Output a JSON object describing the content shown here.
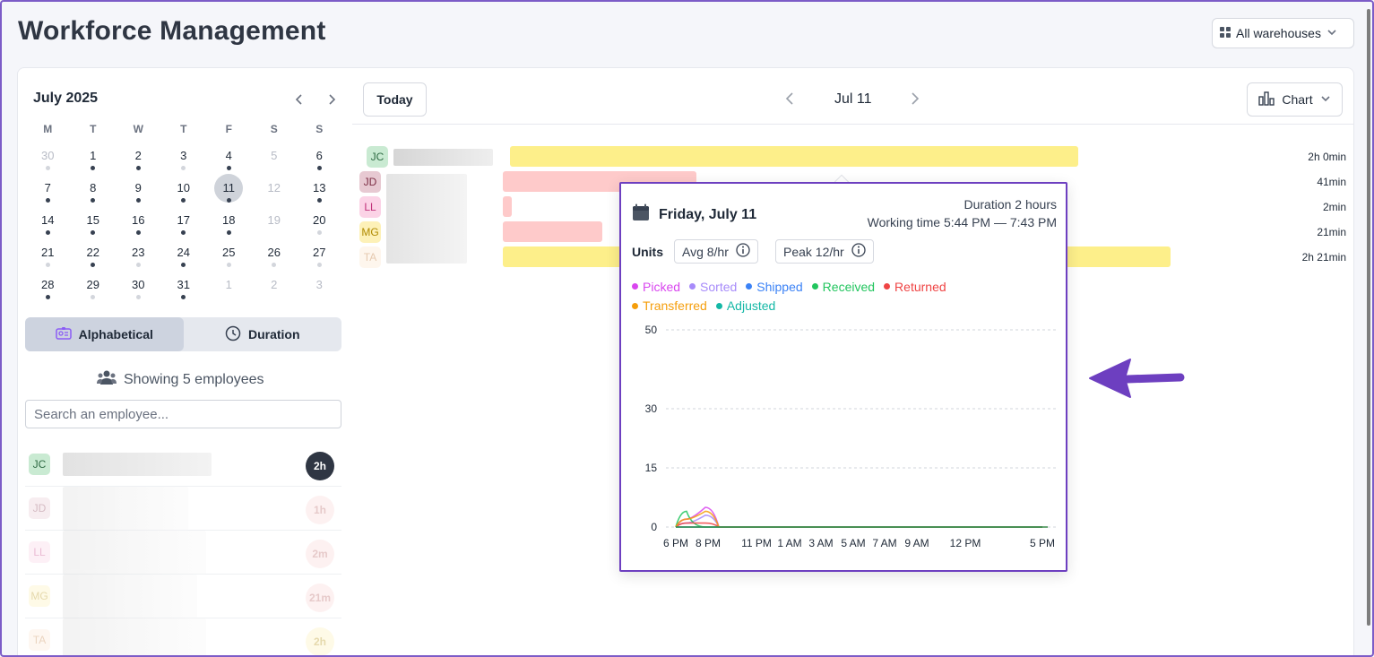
{
  "header": {
    "title": "Workforce Management",
    "warehouse_select": "All warehouses"
  },
  "calendar": {
    "month_label": "July 2025",
    "weekdays": [
      "M",
      "T",
      "W",
      "T",
      "F",
      "S",
      "S"
    ],
    "weeks": [
      [
        {
          "d": "30",
          "m": true,
          "dot": "light"
        },
        {
          "d": "1",
          "dot": "dark"
        },
        {
          "d": "2",
          "dot": "dark"
        },
        {
          "d": "3",
          "dot": "light"
        },
        {
          "d": "4",
          "dot": "dark"
        },
        {
          "d": "5",
          "m": true,
          "dot": ""
        },
        {
          "d": "6",
          "dot": "dark"
        }
      ],
      [
        {
          "d": "7",
          "dot": "dark"
        },
        {
          "d": "8",
          "dot": "dark"
        },
        {
          "d": "9",
          "dot": "dark"
        },
        {
          "d": "10",
          "dot": "dark"
        },
        {
          "d": "11",
          "sel": true,
          "dot": "dark"
        },
        {
          "d": "12",
          "m": true,
          "dot": ""
        },
        {
          "d": "13",
          "dot": "dark"
        }
      ],
      [
        {
          "d": "14",
          "dot": "dark"
        },
        {
          "d": "15",
          "dot": "dark"
        },
        {
          "d": "16",
          "dot": "dark"
        },
        {
          "d": "17",
          "dot": "dark"
        },
        {
          "d": "18",
          "dot": "dark"
        },
        {
          "d": "19",
          "m": true,
          "dot": ""
        },
        {
          "d": "20",
          "dot": "light"
        }
      ],
      [
        {
          "d": "21",
          "dot": "light"
        },
        {
          "d": "22",
          "dot": "dark"
        },
        {
          "d": "23",
          "dot": "light"
        },
        {
          "d": "24",
          "dot": "dark"
        },
        {
          "d": "25",
          "dot": "light"
        },
        {
          "d": "26",
          "dot": "light"
        },
        {
          "d": "27",
          "dot": "light"
        }
      ],
      [
        {
          "d": "28",
          "dot": "dark"
        },
        {
          "d": "29",
          "dot": "light"
        },
        {
          "d": "30",
          "dot": "light"
        },
        {
          "d": "31",
          "dot": "dark"
        },
        {
          "d": "1",
          "m": true,
          "dot": ""
        },
        {
          "d": "2",
          "m": true,
          "dot": ""
        },
        {
          "d": "3",
          "m": true,
          "dot": ""
        }
      ]
    ]
  },
  "sort": {
    "alphabetical": "Alphabetical",
    "duration": "Duration"
  },
  "employees_summary": "Showing 5 employees",
  "search": {
    "placeholder": "Search an employee..."
  },
  "employees": [
    {
      "initials": "JC",
      "duration": "2h",
      "bg": "#c9ead2",
      "fg": "#2f6b44",
      "badge_bg": "#2f3643",
      "badge_fg": "#ffffff"
    },
    {
      "initials": "JD",
      "duration": "1h",
      "bg": "#e7c9d2",
      "fg": "#7c2d44",
      "badge_bg": "#f9d6d6",
      "badge_fg": "#b45a5a"
    },
    {
      "initials": "LL",
      "duration": "2m",
      "bg": "#fbd3e6",
      "fg": "#c0307a",
      "badge_bg": "#f9d6d6",
      "badge_fg": "#b45a5a"
    },
    {
      "initials": "MG",
      "duration": "21m",
      "bg": "#fdf1b8",
      "fg": "#b08a00",
      "badge_bg": "#f9d6d6",
      "badge_fg": "#b45a5a"
    },
    {
      "initials": "TA",
      "duration": "2h",
      "bg": "#fde9d4",
      "fg": "#c17a3a",
      "badge_bg": "#fdf1b8",
      "badge_fg": "#b08a00"
    }
  ],
  "toolbar": {
    "today": "Today",
    "date": "Jul 11",
    "view": "Chart"
  },
  "timeline": [
    {
      "initials": "JC",
      "duration": "2h 0min"
    },
    {
      "initials": "JD",
      "duration": "41min"
    },
    {
      "initials": "LL",
      "duration": "2min"
    },
    {
      "initials": "MG",
      "duration": "21min"
    },
    {
      "initials": "TA",
      "duration": "2h 21min"
    }
  ],
  "tooltip": {
    "date": "Friday, July 11",
    "duration": "Duration 2 hours",
    "working_time": "Working time 5:44 PM — 7:43 PM",
    "units_label": "Units",
    "avg": "Avg 8/hr",
    "peak": "Peak 12/hr"
  },
  "chart_data": {
    "type": "line",
    "title": "",
    "x": [
      "6 PM",
      "8 PM",
      "11 PM",
      "1 AM",
      "3 AM",
      "5 AM",
      "7 AM",
      "9 AM",
      "12 PM",
      "5 PM"
    ],
    "ylim": [
      0,
      50
    ],
    "yticks": [
      0,
      15,
      30,
      50
    ],
    "grid": true,
    "legend_position": "top-left",
    "series": [
      {
        "name": "Picked",
        "color": "#d946ef",
        "values": [
          2,
          5,
          0,
          0,
          0,
          0,
          0,
          0,
          0,
          0
        ]
      },
      {
        "name": "Sorted",
        "color": "#a78bfa",
        "values": [
          1,
          3,
          0,
          0,
          0,
          0,
          0,
          0,
          0,
          0
        ]
      },
      {
        "name": "Shipped",
        "color": "#3b82f6",
        "values": [
          0,
          0,
          0,
          0,
          0,
          0,
          0,
          0,
          0,
          0
        ]
      },
      {
        "name": "Received",
        "color": "#22c55e",
        "values": [
          4,
          0,
          0,
          0,
          0,
          0,
          0,
          0,
          0,
          0
        ]
      },
      {
        "name": "Returned",
        "color": "#ef4444",
        "values": [
          1,
          1,
          0,
          0,
          0,
          0,
          0,
          0,
          0,
          0
        ]
      },
      {
        "name": "Transferred",
        "color": "#f59e0b",
        "values": [
          2,
          4,
          0,
          0,
          0,
          0,
          0,
          0,
          0,
          0
        ]
      },
      {
        "name": "Adjusted",
        "color": "#14b8a6",
        "values": [
          0,
          0,
          0,
          0,
          0,
          0,
          0,
          0,
          0,
          0
        ]
      }
    ]
  }
}
